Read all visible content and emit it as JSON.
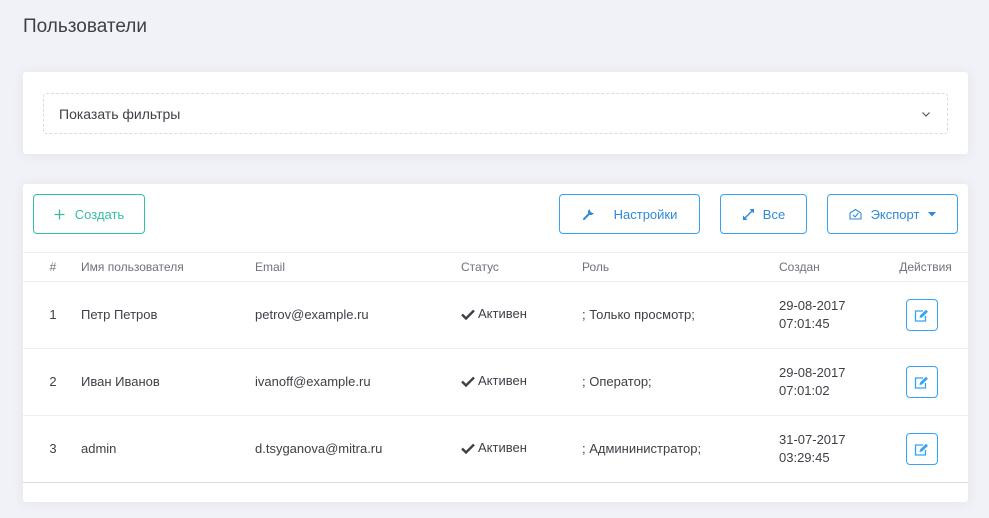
{
  "page": {
    "title": "Пользователи"
  },
  "filters": {
    "toggle_label": "Показать фильтры"
  },
  "toolbar": {
    "create_label": "Создать",
    "settings_label": "Настройки",
    "all_label": "Все",
    "export_label": "Экспорт"
  },
  "table": {
    "headers": {
      "num": "#",
      "username": "Имя пользователя",
      "email": "Email",
      "status": "Статус",
      "role": "Роль",
      "created": "Создан",
      "actions": "Действия"
    },
    "rows": [
      {
        "num": "1",
        "username": "Петр Петров",
        "email": "petrov@example.ru",
        "status": "Активен",
        "role": "; Только просмотр;",
        "created_date": "29-08-2017",
        "created_time": "07:01:45"
      },
      {
        "num": "2",
        "username": "Иван Иванов",
        "email": "ivanoff@example.ru",
        "status": "Активен",
        "role": "; Оператор;",
        "created_date": "29-08-2017",
        "created_time": "07:01:02"
      },
      {
        "num": "3",
        "username": "admin",
        "email": "d.tsyganova@mitra.ru",
        "status": "Активен",
        "role": "; Админинистратор;",
        "created_date": "31-07-2017",
        "created_time": "03:29:45"
      }
    ]
  },
  "colors": {
    "primary": "#36a3f7",
    "success": "#34bfa3",
    "text": "#3f4047"
  },
  "icons": [
    "chevron-down-icon",
    "plus-icon",
    "wrench-icon",
    "expand-icon",
    "export-icon",
    "caret-down-icon",
    "check-icon",
    "edit-icon"
  ]
}
